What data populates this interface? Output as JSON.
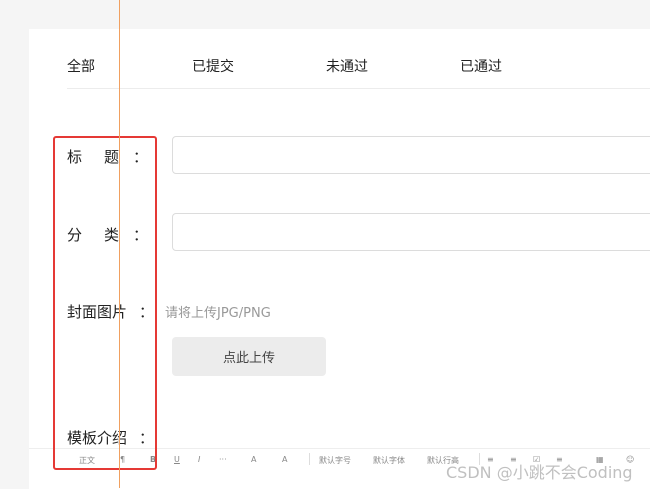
{
  "tabs": [
    {
      "label": "全部"
    },
    {
      "label": "已提交"
    },
    {
      "label": "未通过"
    },
    {
      "label": "已通过"
    }
  ],
  "form": {
    "title_label": "标题",
    "category_label": "分类",
    "cover_label": "封面图片",
    "intro_label": "模板介绍",
    "colon": "：",
    "title_value": "",
    "category_value": "",
    "cover_hint": "请将上传JPG/PNG",
    "upload_button": "点此上传"
  },
  "toolbar": {
    "items": [
      "正文",
      "¶",
      "B",
      "U",
      "I",
      "···",
      "A",
      "A",
      "默认字号",
      "默认字体",
      "默认行高",
      "≡",
      "≡",
      "☑",
      "≡",
      "▦",
      "☺"
    ]
  },
  "watermark": "CSDN @小跳不会Coding",
  "colors": {
    "highlight_box": "#e53935",
    "guide_line": "#f0a060"
  }
}
